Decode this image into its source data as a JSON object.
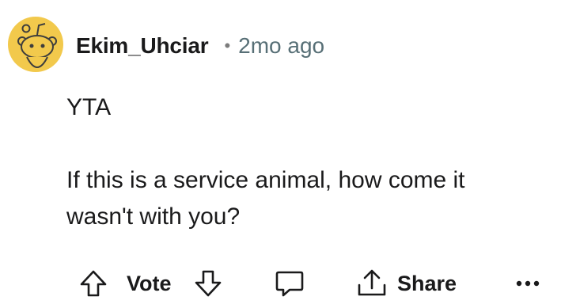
{
  "comment": {
    "username": "Ekim_Uhciar",
    "separator": "•",
    "time": "2mo ago",
    "body": [
      "YTA",
      "",
      "If this is a service animal, how come it",
      "wasn't with you?"
    ]
  },
  "actions": {
    "vote_label": "Vote",
    "share_label": "Share"
  },
  "colors": {
    "avatar_bg": "#f2c94c",
    "text": "#1a1a1b",
    "meta": "#576f76"
  },
  "icons": {
    "avatar": "snoo-avatar-icon",
    "upvote": "arrow-up-outline-icon",
    "downvote": "arrow-down-outline-icon",
    "reply": "speech-bubble-icon",
    "share": "share-upload-icon",
    "more": "more-horizontal-icon"
  }
}
